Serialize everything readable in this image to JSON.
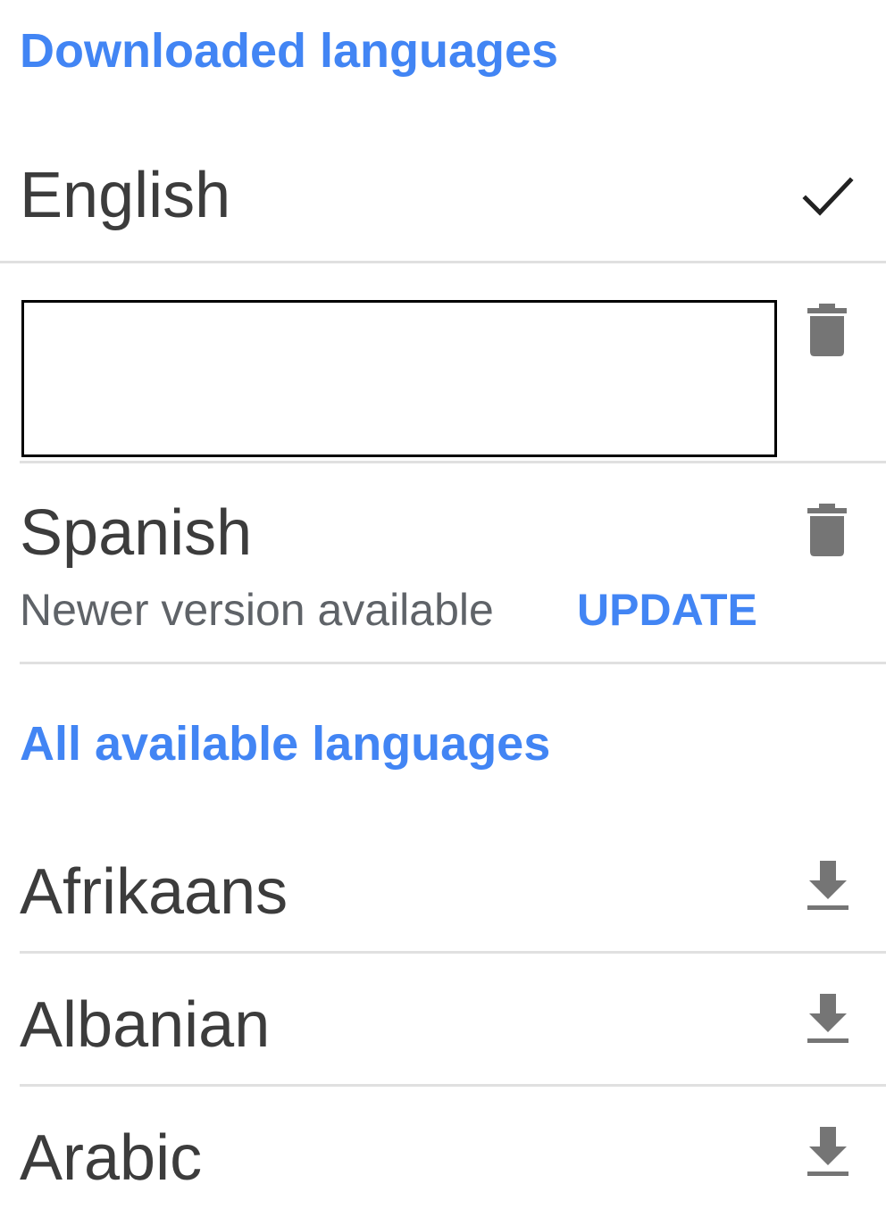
{
  "downloaded_section": {
    "title": "Downloaded languages"
  },
  "downloaded_languages": [
    {
      "name": "English",
      "icon": "check-icon"
    },
    {
      "name": "",
      "icon": "trash-icon",
      "redacted": true
    },
    {
      "name": "Spanish",
      "icon": "trash-icon",
      "status": "Newer version available",
      "action_label": "UPDATE"
    }
  ],
  "available_section": {
    "title": "All available languages"
  },
  "available_languages": [
    {
      "name": "Afrikaans",
      "icon": "download-icon"
    },
    {
      "name": "Albanian",
      "icon": "download-icon"
    },
    {
      "name": "Arabic",
      "icon": "download-icon"
    }
  ],
  "colors": {
    "accent": "#4285f4",
    "text_primary": "#3c3c3c",
    "text_secondary": "#5f6368",
    "icon_gray": "#757575",
    "divider": "#e0e0e0"
  }
}
